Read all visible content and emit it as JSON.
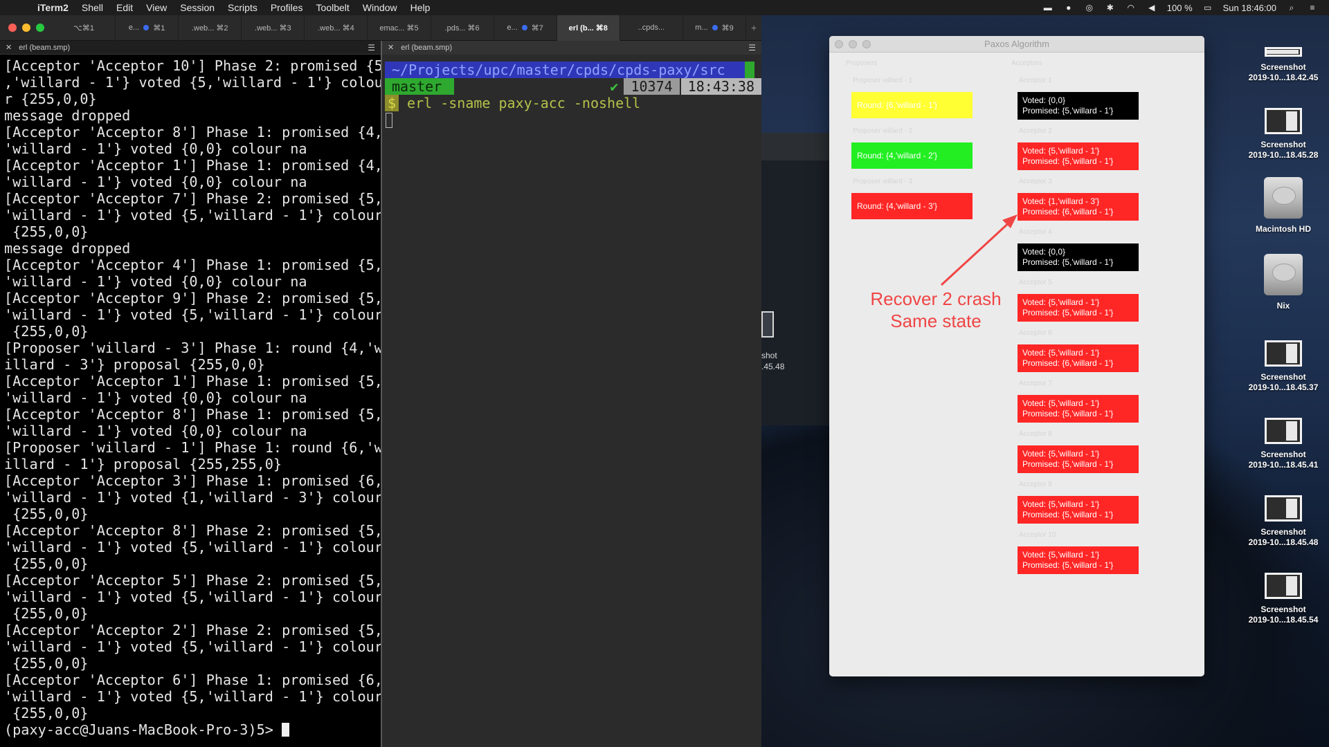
{
  "menubar": {
    "app": "iTerm2",
    "items": [
      "Shell",
      "Edit",
      "View",
      "Session",
      "Scripts",
      "Profiles",
      "Toolbelt",
      "Window",
      "Help"
    ],
    "battery": "100 %",
    "clock": "Sun 18:46:00"
  },
  "iterm": {
    "tabs": [
      {
        "label": "⌥⌘1",
        "dot": false
      },
      {
        "label": "e...",
        "dot": false
      },
      {
        "label": "⌘1",
        "dot": true
      },
      {
        "label": ".web... ⌘2",
        "dot": false
      },
      {
        "label": ".web... ⌘3",
        "dot": false
      },
      {
        "label": ".web... ⌘4",
        "dot": false
      },
      {
        "label": "emac... ⌘5",
        "dot": false
      },
      {
        "label": ".pds... ⌘6",
        "dot": false
      },
      {
        "label": "e...",
        "dot": false
      },
      {
        "label": "⌘7",
        "dot": true
      },
      {
        "label": "erl (b... ⌘8",
        "dot": false,
        "active": true
      },
      {
        "label": "..cpds...",
        "dot": false
      },
      {
        "label": "m...",
        "dot": false
      },
      {
        "label": "⌘9",
        "dot": true
      }
    ],
    "left_pane": {
      "title": "erl (beam.smp)",
      "lines": [
        "[Acceptor 'Acceptor 10'] Phase 2: promised {5",
        ",'willard - 1'} voted {5,'willard - 1'} colou",
        "r {255,0,0}",
        "message dropped",
        "[Acceptor 'Acceptor 8'] Phase 1: promised {4,",
        "'willard - 1'} voted {0,0} colour na",
        "[Acceptor 'Acceptor 1'] Phase 1: promised {4,",
        "'willard - 1'} voted {0,0} colour na",
        "[Acceptor 'Acceptor 7'] Phase 2: promised {5,",
        "'willard - 1'} voted {5,'willard - 1'} colour",
        " {255,0,0}",
        "message dropped",
        "[Acceptor 'Acceptor 4'] Phase 1: promised {5,",
        "'willard - 1'} voted {0,0} colour na",
        "[Acceptor 'Acceptor 9'] Phase 2: promised {5,",
        "'willard - 1'} voted {5,'willard - 1'} colour",
        " {255,0,0}",
        "[Proposer 'willard - 3'] Phase 1: round {4,'w",
        "illard - 3'} proposal {255,0,0}",
        "[Acceptor 'Acceptor 1'] Phase 1: promised {5,",
        "'willard - 1'} voted {0,0} colour na",
        "[Acceptor 'Acceptor 8'] Phase 1: promised {5,",
        "'willard - 1'} voted {0,0} colour na",
        "[Proposer 'willard - 1'] Phase 1: round {6,'w",
        "illard - 1'} proposal {255,255,0}",
        "[Acceptor 'Acceptor 3'] Phase 1: promised {6,",
        "'willard - 1'} voted {1,'willard - 3'} colour",
        " {255,0,0}",
        "[Acceptor 'Acceptor 8'] Phase 2: promised {5,",
        "'willard - 1'} voted {5,'willard - 1'} colour",
        " {255,0,0}",
        "[Acceptor 'Acceptor 5'] Phase 2: promised {5,",
        "'willard - 1'} voted {5,'willard - 1'} colour",
        " {255,0,0}",
        "[Acceptor 'Acceptor 2'] Phase 2: promised {5,",
        "'willard - 1'} voted {5,'willard - 1'} colour",
        " {255,0,0}",
        "[Acceptor 'Acceptor 6'] Phase 1: promised {6,",
        "'willard - 1'} voted {5,'willard - 1'} colour",
        " {255,0,0}"
      ],
      "prompt": "(paxy-acc@Juans-MacBook-Pro-3)5> "
    },
    "right_pane": {
      "title": "erl (beam.smp)",
      "path": "~/Projects/upc/master/cpds/cpds-paxy/src",
      "branch": "master",
      "check": "✔",
      "pid": "10374",
      "time": "18:43:38",
      "dollar": "$",
      "command": "erl -sname paxy-acc -noshell"
    }
  },
  "paxos": {
    "title": "Paxos Algorithm",
    "proposers_label": "Proposers",
    "acceptors_label": "Acceptors",
    "proposers": [
      {
        "label": "Proposer willard - 1",
        "text": "Round: {6,'willard - 1'}",
        "color": "#ffff33",
        "text_color": "#ffffff"
      },
      {
        "label": "Proposer willard - 2",
        "text": "Round: {4,'willard - 2'}",
        "color": "#22ee22",
        "text_color": "#ffffff"
      },
      {
        "label": "Proposer willard - 3",
        "text": "Round: {4,'willard - 3'}",
        "color": "#ff2626",
        "text_color": "#ffffff"
      }
    ],
    "acceptors": [
      {
        "label": "Acceptor 1",
        "voted": "Voted: {0,0}",
        "promised": "Promised: {5,'willard - 1'}",
        "color": "#000000"
      },
      {
        "label": "Acceptor 2",
        "voted": "Voted: {5,'willard - 1'}",
        "promised": "Promised: {5,'willard - 1'}",
        "color": "#ff2626"
      },
      {
        "label": "Acceptor 3",
        "voted": "Voted: {1,'willard - 3'}",
        "promised": "Promised: {6,'willard - 1'}",
        "color": "#ff2626"
      },
      {
        "label": "Acceptor 4",
        "voted": "Voted: {0,0}",
        "promised": "Promised: {5,'willard - 1'}",
        "color": "#000000"
      },
      {
        "label": "Acceptor 5",
        "voted": "Voted: {5,'willard - 1'}",
        "promised": "Promised: {5,'willard - 1'}",
        "color": "#ff2626"
      },
      {
        "label": "Acceptor 6",
        "voted": "Voted: {5,'willard - 1'}",
        "promised": "Promised: {6,'willard - 1'}",
        "color": "#ff2626"
      },
      {
        "label": "Acceptor 7",
        "voted": "Voted: {5,'willard - 1'}",
        "promised": "Promised: {5,'willard - 1'}",
        "color": "#ff2626"
      },
      {
        "label": "Acceptor 8",
        "voted": "Voted: {5,'willard - 1'}",
        "promised": "Promised: {5,'willard - 1'}",
        "color": "#ff2626"
      },
      {
        "label": "Acceptor 9",
        "voted": "Voted: {5,'willard - 1'}",
        "promised": "Promised: {5,'willard - 1'}",
        "color": "#ff2626"
      },
      {
        "label": "Acceptor 10",
        "voted": "Voted: {5,'willard - 1'}",
        "promised": "Promised: {5,'willard - 1'}",
        "color": "#ff2626"
      }
    ],
    "annotation": {
      "line1": "Recover 2 crash",
      "line2": "Same state",
      "color": "#f04545"
    }
  },
  "behind_window": {
    "label1": "shot",
    "label2": ".45.48"
  },
  "desktop_icons": [
    {
      "name": "Screenshot",
      "sub": "2019-10...18.42.45",
      "kind": "bar"
    },
    {
      "name": "Screenshot",
      "sub": "2019-10...18.45.28",
      "kind": "shot"
    },
    {
      "name": "Macintosh HD",
      "sub": "",
      "kind": "disk"
    },
    {
      "name": "Nix",
      "sub": "",
      "kind": "disk"
    },
    {
      "name": "Screenshot",
      "sub": "2019-10...18.45.37",
      "kind": "shot"
    },
    {
      "name": "Screenshot",
      "sub": "2019-10...18.45.41",
      "kind": "shot"
    },
    {
      "name": "Screenshot",
      "sub": "2019-10...18.45.48",
      "kind": "shot"
    },
    {
      "name": "Screenshot",
      "sub": "2019-10...18.45.54",
      "kind": "shot"
    }
  ]
}
